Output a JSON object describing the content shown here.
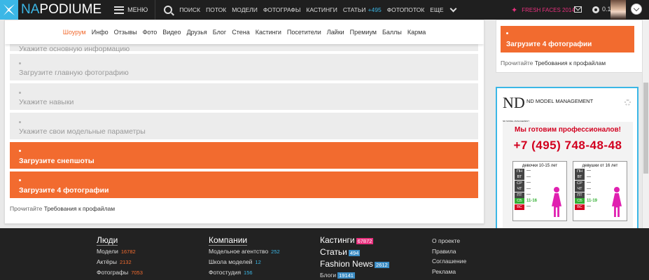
{
  "header": {
    "logo_prefix": "NA",
    "logo_suffix": "PODIUME",
    "menu_label": "МЕНЮ",
    "nav": [
      "ПОИСК",
      "ПОТОК",
      "МОДЕЛИ",
      "ФОТОГРАФЫ",
      "КАСТИНГИ",
      "СТАТЬИ",
      "ФОТОПОТОК",
      "ЕЩЕ"
    ],
    "articles_count": "+495",
    "fresh_faces": "FRESH FACES 2014",
    "balance": "0.1"
  },
  "tabs": [
    "Шоурум",
    "Инфо",
    "Отзывы",
    "Фото",
    "Видео",
    "Друзья",
    "Блог",
    "Стена",
    "Кастинги",
    "Посетители",
    "Лайки",
    "Премиум",
    "Баллы",
    "Карма"
  ],
  "checklist": [
    {
      "label": "Укажите основную информацию",
      "status": "pending"
    },
    {
      "label": "Загрузите главную фотографию",
      "status": "pending"
    },
    {
      "label": "Укажите навыки",
      "status": "pending"
    },
    {
      "label": "Укажите свои модельные параметры",
      "status": "pending"
    },
    {
      "label": "Загрузите снепшоты",
      "status": "required"
    },
    {
      "label": "Загрузите 4 фотографии",
      "status": "required"
    }
  ],
  "requirements": {
    "prefix": "Прочитайте",
    "link": "Требования к профайлам"
  },
  "right_panel": {
    "item_label": "Загрузите 4 фотографии"
  },
  "ad": {
    "logo": "ND",
    "logo_sub": "ND MODEL MANAGEMENT",
    "name": "ND MODEL MANAGEMENT",
    "headline": "Мы готовим профессионалов!",
    "phone": "+7 (495) 748-48-48",
    "groups": [
      {
        "title": "девочки 10-15 лет",
        "days": [
          "ПН",
          "ВТ",
          "СР",
          "ЧТ",
          "ПТ",
          "СБ",
          "ВС"
        ],
        "values": [
          "—",
          "—",
          "—",
          "—",
          "—",
          "11-16",
          "—"
        ]
      },
      {
        "title": "девушки от 16 лет",
        "days": [
          "ПН",
          "ВТ",
          "СР",
          "ЧТ",
          "ПТ",
          "СБ",
          "ВС"
        ],
        "values": [
          "—",
          "—",
          "—",
          "—",
          "—",
          "11-19",
          "—"
        ]
      }
    ]
  },
  "footer": {
    "people": {
      "title": "Люди",
      "items": [
        {
          "label": "Модели",
          "count": "16782"
        },
        {
          "label": "Актёры",
          "count": "2132"
        },
        {
          "label": "Фотографы",
          "count": "7053"
        }
      ]
    },
    "companies": {
      "title": "Компании",
      "items": [
        {
          "label": "Модельное агентство",
          "count": "252"
        },
        {
          "label": "Школа моделей",
          "count": "12"
        },
        {
          "label": "Фотостудия",
          "count": "156"
        }
      ]
    },
    "media": [
      {
        "label": "Кастинги",
        "count": "67872"
      },
      {
        "label": "Статьи",
        "count": "494"
      },
      {
        "label": "Fashion News",
        "count": "2612"
      },
      {
        "label": "Блоги",
        "count": "19141"
      }
    ],
    "links": [
      "О проекте",
      "Правила",
      "Соглашение",
      "Реклама"
    ]
  },
  "colors": {
    "accent": "#f26b2f",
    "brand_blue": "#3bb7e6",
    "pink": "#e8317e",
    "dark": "#1f1f1f"
  }
}
